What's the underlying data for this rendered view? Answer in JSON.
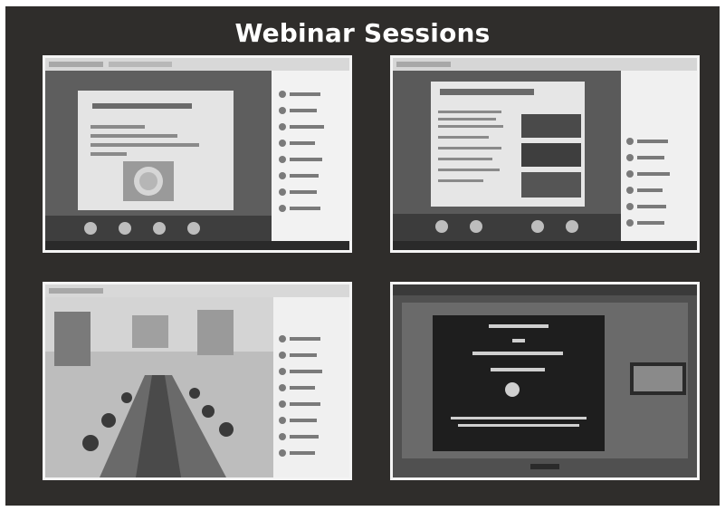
{
  "page": {
    "title": "Webinar Sessions"
  },
  "colors": {
    "background": "#2f2d2b",
    "title": "#ffffff",
    "frame": "#f4f4f4"
  },
  "screenshots": [
    {
      "description": "webinar-screen-slide-with-device"
    },
    {
      "description": "webinar-screen-slide-with-images"
    },
    {
      "description": "webinar-screen-conference-room"
    },
    {
      "description": "webinar-screen-title-slide"
    }
  ]
}
